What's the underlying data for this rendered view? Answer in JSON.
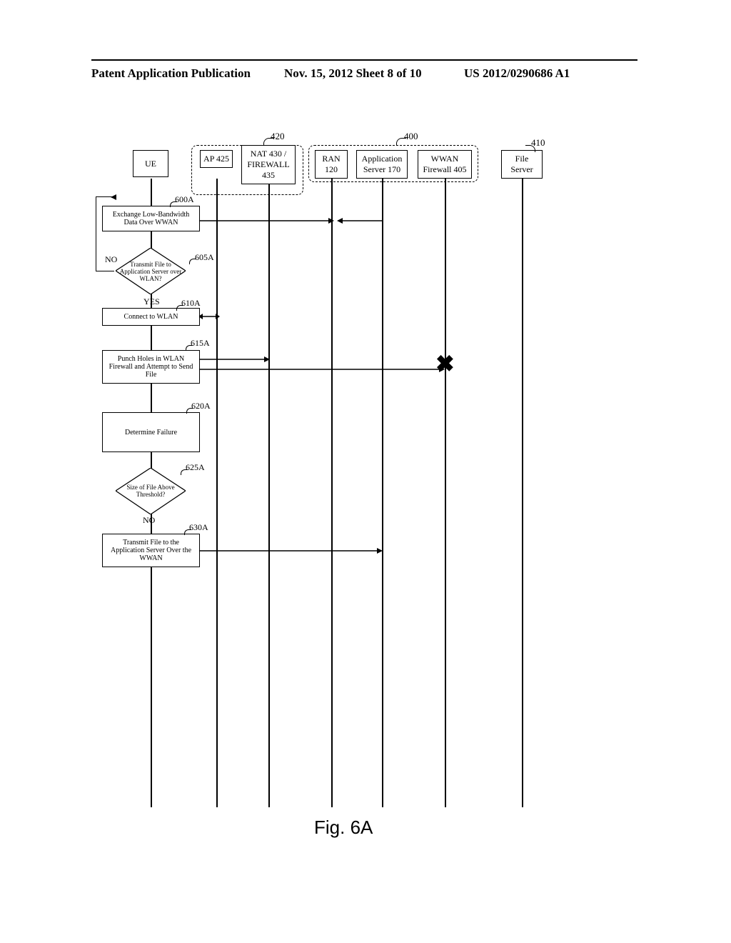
{
  "header": {
    "left": "Patent Application Publication",
    "center": "Nov. 15, 2012  Sheet 8 of 10",
    "right": "US 2012/0290686 A1"
  },
  "columns": {
    "ue": "UE",
    "ap": "AP 425",
    "nat": "NAT 430 / FIREWALL 435",
    "ran": "RAN 120",
    "as": "Application Server 170",
    "wwan": "WWAN Firewall 405",
    "file": "File Server"
  },
  "refs": {
    "r420": "420",
    "r400": "400",
    "r410": "410"
  },
  "steps": {
    "s600": {
      "ref": "600A",
      "text": "Exchange Low-Bandwidth Data Over WWAN"
    },
    "s605": {
      "ref": "605A",
      "text": "Transmit File to Application Server over WLAN?"
    },
    "s610": {
      "ref": "610A",
      "text": "Connect to WLAN"
    },
    "s615": {
      "ref": "615A",
      "text": "Punch Holes in WLAN Firewall and Attempt to Send File"
    },
    "s620": {
      "ref": "620A",
      "text": "Determine Failure"
    },
    "s625": {
      "ref": "625A",
      "text": "Size of File Above Threshold?"
    },
    "s630": {
      "ref": "630A",
      "text": "Transmit File to the Application Server Over the WWAN"
    }
  },
  "labels": {
    "no": "NO",
    "yes": "YES"
  },
  "figure": "Fig. 6A"
}
